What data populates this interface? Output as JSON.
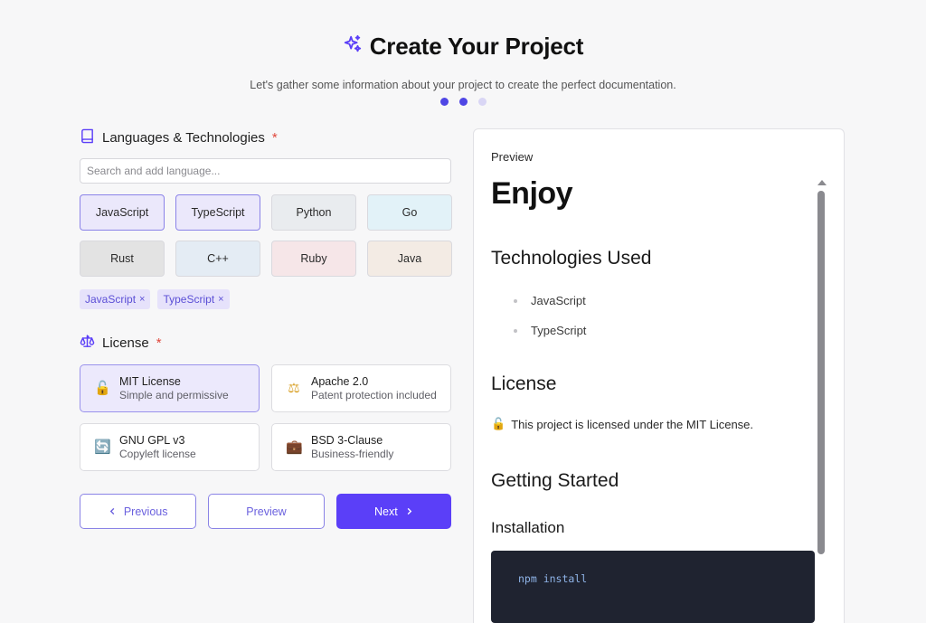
{
  "header": {
    "title": "Create Your Project",
    "subtitle": "Let's gather some information about your project to create the perfect documentation.",
    "steps_total": 3,
    "steps_completed": 2,
    "icon": "sparkles-icon"
  },
  "languages": {
    "heading": "Languages & Technologies",
    "required_mark": "*",
    "search_placeholder": "Search and add language...",
    "options": [
      {
        "label": "JavaScript",
        "bg": "#ebe8fb",
        "selected": true
      },
      {
        "label": "TypeScript",
        "bg": "#ebe8fb",
        "selected": true
      },
      {
        "label": "Python",
        "bg": "#e9ecef",
        "selected": false
      },
      {
        "label": "Go",
        "bg": "#e2f2f8",
        "selected": false
      },
      {
        "label": "Rust",
        "bg": "#e3e3e3",
        "selected": false
      },
      {
        "label": "C++",
        "bg": "#e4ecf4",
        "selected": false
      },
      {
        "label": "Ruby",
        "bg": "#f6e6e8",
        "selected": false
      },
      {
        "label": "Java",
        "bg": "#f3ebe4",
        "selected": false
      }
    ],
    "chips": [
      {
        "label": "JavaScript",
        "remove": "×"
      },
      {
        "label": "TypeScript",
        "remove": "×"
      }
    ]
  },
  "license": {
    "heading": "License",
    "required_mark": "*",
    "options": [
      {
        "name": "MIT License",
        "desc": "Simple and permissive",
        "icon": "unlocked-icon",
        "glyph": "🔓",
        "selected": true
      },
      {
        "name": "Apache 2.0",
        "desc": "Patent protection included",
        "icon": "scales-icon",
        "glyph": "⚖",
        "selected": false
      },
      {
        "name": "GNU GPL v3",
        "desc": "Copyleft license",
        "icon": "refresh-icon",
        "glyph": "🔄",
        "selected": false
      },
      {
        "name": "BSD 3-Clause",
        "desc": "Business-friendly",
        "icon": "briefcase-icon",
        "glyph": "💼",
        "selected": false
      }
    ]
  },
  "nav": {
    "previous": "Previous",
    "preview": "Preview",
    "next": "Next"
  },
  "preview": {
    "label": "Preview",
    "h1": "Enjoy",
    "tech_heading": "Technologies Used",
    "tech_items": [
      "JavaScript",
      "TypeScript"
    ],
    "license_heading": "License",
    "license_glyph": "🔓",
    "license_text": "This project is licensed under the MIT License.",
    "getting_started": "Getting Started",
    "installation": "Installation",
    "code": "npm install"
  },
  "colors": {
    "accent": "#5b3ff8",
    "accent_light": "#ece9fc",
    "required": "#e0473c"
  }
}
